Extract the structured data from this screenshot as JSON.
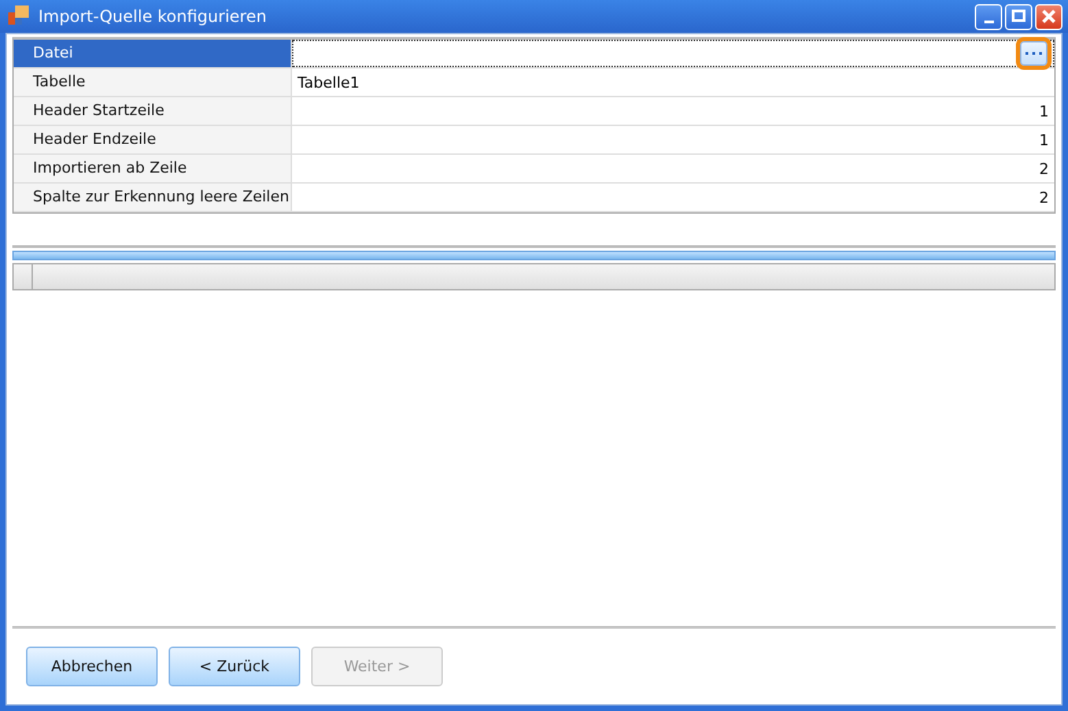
{
  "window": {
    "title": "Import-Quelle konfigurieren"
  },
  "properties": [
    {
      "name": "Datei",
      "kind": "file",
      "selected": true,
      "browse_highlighted": true
    },
    {
      "name": "Tabelle",
      "value": "Tabelle1",
      "kind": "text",
      "selected": false
    },
    {
      "name": "Header Startzeile",
      "value": "1",
      "kind": "number",
      "selected": false
    },
    {
      "name": "Header Endzeile",
      "value": "1",
      "kind": "number",
      "selected": false
    },
    {
      "name": "Importieren ab Zeile",
      "value": "2",
      "kind": "number",
      "selected": false
    },
    {
      "name": "Spalte zur Erkennung leere Zeilen",
      "value": "2",
      "kind": "number",
      "selected": false
    }
  ],
  "buttons": [
    {
      "label": "Abbrechen",
      "disabled": false
    },
    {
      "label": "< Zurück",
      "disabled": false
    },
    {
      "label": "Weiter >",
      "disabled": true
    }
  ]
}
